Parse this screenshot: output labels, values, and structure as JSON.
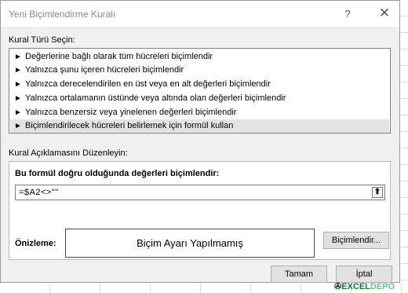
{
  "dialog": {
    "title": "Yeni Biçimlendirme Kuralı",
    "help_glyph": "?",
    "close_glyph": "✕",
    "rule_type_label": "Kural Türü Seçin:",
    "rule_types": [
      {
        "label": "Değerlerine bağlı olarak tüm hücreleri biçimlendir",
        "selected": false
      },
      {
        "label": "Yalnızca şunu içeren hücreleri biçimlendir",
        "selected": false
      },
      {
        "label": "Yalnızca derecelendirilen en üst veya en alt değerleri biçimlendir",
        "selected": false
      },
      {
        "label": "Yalnızca ortalamanın üstünde veya altında olan değerleri biçimlendir",
        "selected": false
      },
      {
        "label": "Yalnızca benzersiz veya yinelenen değerleri biçimlendir",
        "selected": false
      },
      {
        "label": "Biçimlendirilecek hücreleri belirlemek için formül kullan",
        "selected": true
      }
    ],
    "arrow_glyph": "►",
    "rule_description_label": "Kural Açıklamasını Düzenleyin:",
    "formula_label": "Bu formül doğru olduğunda değerleri biçimlendir:",
    "formula_value": "=$A2<>\"\"",
    "collapse_glyph": "⬆",
    "preview_label": "Önizleme:",
    "preview_text": "Biçim Ayarı Yapılmamış",
    "format_button": "Biçimlendir...",
    "ok_button": "Tamam",
    "cancel_button": "İptal"
  },
  "watermark": {
    "part1": "EXCEL",
    "part2": "DEPO"
  },
  "colors": {
    "selected_row": "#e3e3e3",
    "dialog_bg": "#f0f0f0"
  }
}
